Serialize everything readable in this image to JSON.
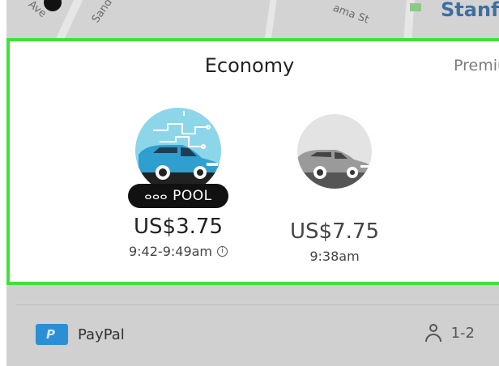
{
  "map": {
    "labels": [
      "Ave",
      "Sand",
      "ama St",
      "Stanf"
    ]
  },
  "panel": {
    "title": "Economy",
    "next_tab": "Premium"
  },
  "options": [
    {
      "badge": "POOL",
      "badge_icon": "group-icon",
      "price": "US$3.75",
      "eta": "9:42-9:49am",
      "info_icon": "info-icon"
    },
    {
      "price": "US$7.75",
      "eta": "9:38am"
    }
  ],
  "payment": {
    "method": "PayPal",
    "icon": "paypal-icon"
  },
  "seats": {
    "icon": "person-icon",
    "value": "1-2"
  },
  "colors": {
    "selection_border": "#3ee23b",
    "pool_circle": "#8dd6ea",
    "pool_car": "#2f9fd0",
    "paypal_blue": "#2c8fd6"
  }
}
